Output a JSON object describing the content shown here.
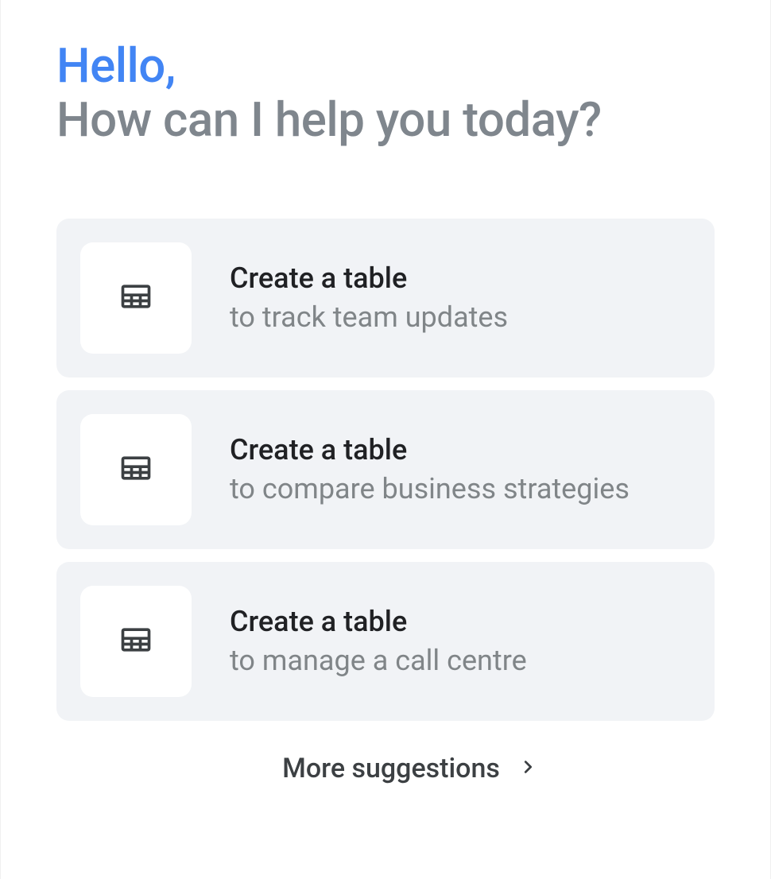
{
  "greeting": {
    "hello": "Hello,",
    "subtitle": "How can I help you today?"
  },
  "suggestions": [
    {
      "icon": "table-icon",
      "title": "Create a table",
      "description": "to track team updates"
    },
    {
      "icon": "table-icon",
      "title": "Create a table",
      "description": "to compare business strategies"
    },
    {
      "icon": "table-icon",
      "title": "Create a table",
      "description": "to manage a call centre"
    }
  ],
  "more": {
    "label": "More suggestions"
  },
  "colors": {
    "accent": "#4285f4",
    "muted": "#7f868d",
    "cardBg": "#f1f3f6"
  }
}
